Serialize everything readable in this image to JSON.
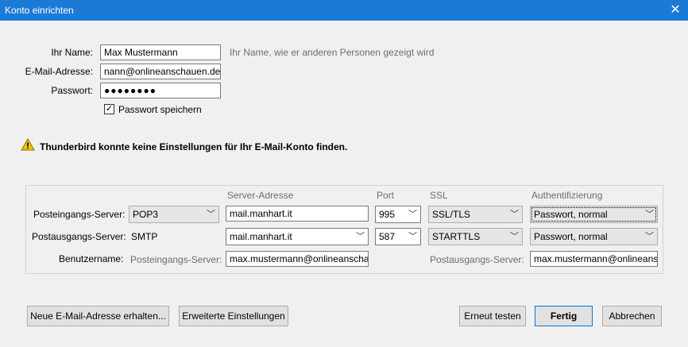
{
  "window": {
    "title": "Konto einrichten",
    "close_glyph": "✕"
  },
  "identity": {
    "name_label": "Ihr Name:",
    "name_value": "Max Mustermann",
    "name_hint": "Ihr Name, wie er anderen Personen gezeigt wird",
    "email_label": "E-Mail-Adresse:",
    "email_value": "nann@onlineanschauen.de",
    "password_label": "Passwort:",
    "password_value": "●●●●●●●●",
    "remember_label": "Passwort speichern",
    "remember_checked": true
  },
  "warning": {
    "icon": "warning-icon",
    "text": "Thunderbird konnte keine Einstellungen für Ihr E-Mail-Konto finden."
  },
  "server_table": {
    "headers": {
      "address": "Server-Adresse",
      "port": "Port",
      "ssl": "SSL",
      "auth": "Authentifizierung"
    },
    "incoming": {
      "label": "Posteingangs-Server:",
      "protocol": "POP3",
      "address": "mail.manhart.it",
      "port": "995",
      "ssl": "SSL/TLS",
      "auth": "Passwort, normal"
    },
    "outgoing": {
      "label": "Postausgangs-Server:",
      "protocol": "SMTP",
      "address": "mail.manhart.it",
      "port": "587",
      "ssl": "STARTTLS",
      "auth": "Passwort, normal"
    },
    "username": {
      "label": "Benutzername:",
      "incoming_label": "Posteingangs-Server:",
      "incoming_value": "max.mustermann@onlineanscha",
      "outgoing_label": "Postausgangs-Server:",
      "outgoing_value": "max.mustermann@onlineans"
    }
  },
  "buttons": {
    "new_address": "Neue E-Mail-Adresse erhalten...",
    "advanced": "Erweiterte Einstellungen",
    "retest": "Erneut testen",
    "done": "Fertig",
    "cancel": "Abbrechen"
  }
}
